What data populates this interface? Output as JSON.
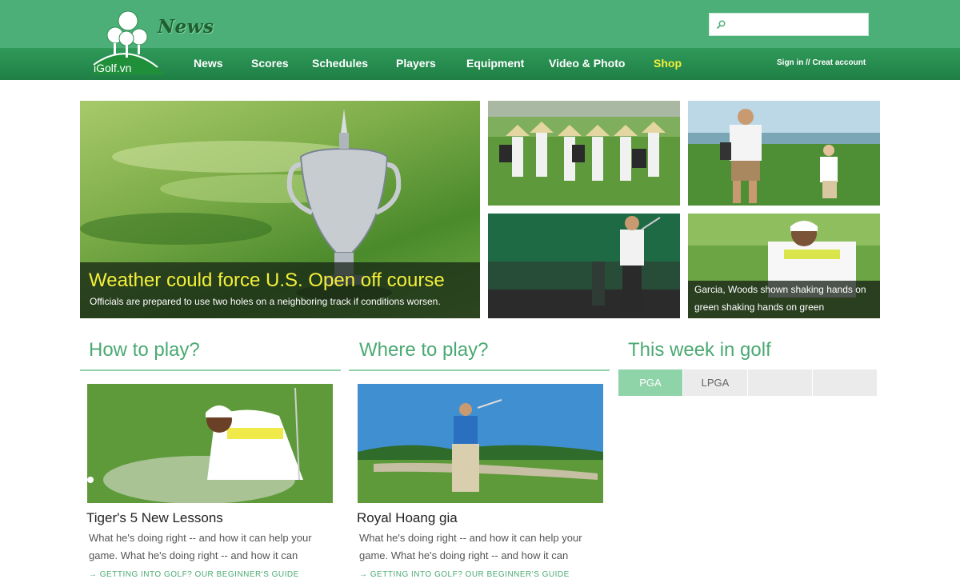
{
  "header": {
    "logo_text": "iGolf.vn",
    "section_title": "News",
    "search": {
      "placeholder": "",
      "value": ""
    },
    "nav": [
      "News",
      "Scores",
      "Schedules",
      "Players",
      "Equipment",
      "Video & Photo",
      "Shop"
    ],
    "auth": {
      "sign_in": "Sign in",
      "separator": "//",
      "create": "Creat account"
    }
  },
  "hero": {
    "title": "Weather could force U.S. Open off course",
    "desc": "Officials are prepared to use two holes on a neighboring track if conditions worsen."
  },
  "thumbs": [
    {
      "caption": ""
    },
    {
      "caption": ""
    },
    {
      "caption": ""
    },
    {
      "caption": "Garcia, Woods shown shaking hands on green shaking hands on green"
    }
  ],
  "sections": {
    "how": {
      "heading": "How to play?",
      "title": "Tiger's 5 New Lessons",
      "desc": "What he's doing right -- and how it can help your game. What he's doing right -- and how it can",
      "link": "→ GETTING INTO GOLF? OUR BEGINNER'S GUIDE"
    },
    "where": {
      "heading": "Where to play?",
      "title": "Royal Hoang gia",
      "desc": "What he's doing right -- and how it can help your game. What he's doing right -- and how it can",
      "link": "→ GETTING INTO GOLF? OUR BEGINNER'S GUIDE"
    },
    "week": {
      "heading": "This week in golf",
      "tabs": [
        "PGA",
        "LPGA",
        "",
        ""
      ]
    }
  },
  "colors": {
    "header": "#4caf78",
    "nav": "#2f9a5a",
    "accent": "#4aa972",
    "shop": "#f4f03a"
  }
}
